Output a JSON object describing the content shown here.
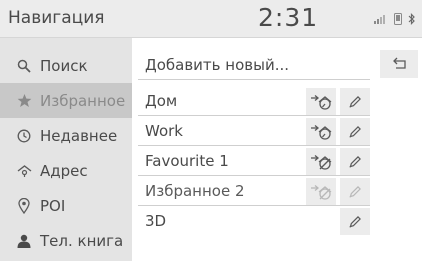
{
  "header": {
    "title": "Навигация",
    "clock": "2:31"
  },
  "status_icons": [
    "signal-icon",
    "phone-icon",
    "bluetooth-icon"
  ],
  "sidebar": {
    "items": [
      {
        "label": "Поиск",
        "icon": "search-icon"
      },
      {
        "label": "Избранное",
        "icon": "star-icon",
        "selected": true
      },
      {
        "label": "Недавнее",
        "icon": "clock-icon"
      },
      {
        "label": "Адрес",
        "icon": "address-icon"
      },
      {
        "label": "POI",
        "icon": "pin-icon"
      },
      {
        "label": "Тел. книга",
        "icon": "person-icon"
      }
    ]
  },
  "list": {
    "add_new": "Добавить новый...",
    "items": [
      {
        "label": "Дом",
        "home_button": true,
        "home_disabled": false,
        "edit_disabled": false
      },
      {
        "label": "Work",
        "home_button": true,
        "home_disabled": false,
        "edit_disabled": false
      },
      {
        "label": "Favourite 1",
        "home_button": true,
        "home_disabled": true,
        "edit_disabled": false
      },
      {
        "label": "Избранное 2",
        "home_button": true,
        "home_disabled": true,
        "edit_disabled": true
      },
      {
        "label": "3D",
        "home_button": false,
        "home_disabled": false,
        "edit_disabled": false
      }
    ]
  },
  "back_icon": "back-icon"
}
